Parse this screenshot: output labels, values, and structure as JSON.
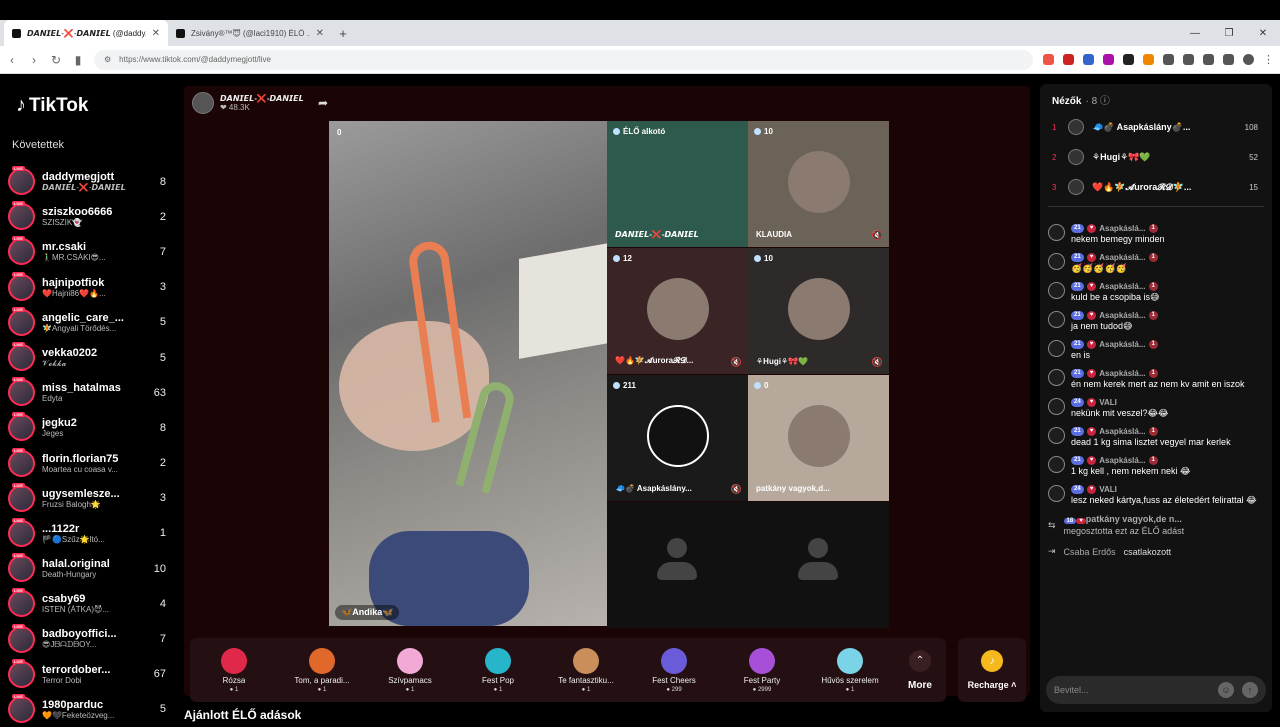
{
  "browser": {
    "tabs": [
      {
        "title": "𝘿𝘼𝙉𝙄𝙀𝙇-❌-𝘿𝘼𝙉𝙄𝙀𝙇 (@daddy..."
      },
      {
        "title": "Zsivány®™😇 (@laci1910) ÉLŐ ..."
      }
    ],
    "url": "https://www.tiktok.com/@daddymegjott/live"
  },
  "sidebar": {
    "logo": "TikTok",
    "following_title": "Követettek",
    "items": [
      {
        "name": "daddymegjott",
        "desc": "𝘿𝘼𝙉𝙄𝙀𝙇-❌-𝘿𝘼𝙉𝙄𝙀𝙇",
        "count": "8"
      },
      {
        "name": "sziszkoo6666",
        "desc": "SZISZIK👻",
        "count": "2"
      },
      {
        "name": "mr.csaki",
        "desc": "🚶‍♂️MR.CSÁKI😎...",
        "count": "7"
      },
      {
        "name": "hajnipotfiok",
        "desc": "❤️Hajni86❤️🔥...",
        "count": "3"
      },
      {
        "name": "angelic_care_...",
        "desc": "🧚Angyali Törődés...",
        "count": "5"
      },
      {
        "name": "vekka0202",
        "desc": "𝓥𝓮𝓴𝓴𝓪",
        "count": "5"
      },
      {
        "name": "miss_hatalmas",
        "desc": "Edyta",
        "count": "63"
      },
      {
        "name": "jegku2",
        "desc": "Jeges",
        "count": "8"
      },
      {
        "name": "florin.florian75",
        "desc": "Moartea cu coasa v...",
        "count": "2"
      },
      {
        "name": "ugysemlesze...",
        "desc": "Fruzsi Balogh🌟",
        "count": "3"
      },
      {
        "name": "...1122r",
        "desc": "🏴🔵Szűz🌟ltó...",
        "count": "1"
      },
      {
        "name": "halal.original",
        "desc": "Death-Hungary",
        "count": "10"
      },
      {
        "name": "csaby69",
        "desc": "ISTEN (ÁTKA)😈...",
        "count": "4"
      },
      {
        "name": "badboyoffici...",
        "desc": "😎JᗷᗩᗪᗷOY...",
        "count": "7"
      },
      {
        "name": "terrordober...",
        "desc": "Terror Dobi",
        "count": "67"
      },
      {
        "name": "1980parduc",
        "desc": "🧡🖤Feketeözveg...",
        "count": "5"
      }
    ]
  },
  "stream": {
    "host_name": "𝘿𝘼𝙉𝙄𝙀𝙇-❌-𝘿𝘼𝙉𝙄𝙀𝙇",
    "host_likes": "❤ 48.3K",
    "main_guest": {
      "count": "0",
      "name": "🦋Andika🦋"
    },
    "tiles": [
      {
        "count": "ÉLŐ alkotó",
        "label": "𝘿𝘼𝙉𝙄𝙀𝙇-❌-𝘿𝘼𝙉𝙄𝙀𝙇",
        "bg": "#2d5a4c"
      },
      {
        "count": "10",
        "label": "KLAUDIA",
        "bg": "#6b6258"
      },
      {
        "count": "12",
        "label": "❤️🔥🧚𝓐urora𝓡𝓓...",
        "bg": "#3a2426"
      },
      {
        "count": "10",
        "label": "⚘Hugi⚘🎀💚",
        "bg": "#2e2a2a"
      },
      {
        "count": "211",
        "label": "🧢💣 Asapkáslány...",
        "bg": "#1a1a1a"
      },
      {
        "count": "0",
        "label": "patkány vagyok,d...",
        "bg": "#b6a99c"
      }
    ],
    "recommended": "Ajánlott ÉLŐ adások"
  },
  "gifts": [
    {
      "name": "Rózsa",
      "price": "1",
      "color": "#e0294a"
    },
    {
      "name": "Tom, a paradi...",
      "price": "1",
      "color": "#e0682a"
    },
    {
      "name": "Szívpamacs",
      "price": "1",
      "color": "#f2a9d6"
    },
    {
      "name": "Fest Pop",
      "price": "1",
      "color": "#26b5c9"
    },
    {
      "name": "Te fantasztiku...",
      "price": "1",
      "color": "#c98e5a"
    },
    {
      "name": "Fest Cheers",
      "price": "299",
      "color": "#6a5bd8"
    },
    {
      "name": "Fest Party",
      "price": "2999",
      "color": "#a84fd8"
    },
    {
      "name": "Hűvös szerelem",
      "price": "1",
      "color": "#7bd3e8"
    }
  ],
  "more_label": "More",
  "recharge_label": "Recharge",
  "viewers": {
    "title": "Nézők",
    "count": "8",
    "top": [
      {
        "rank": "1",
        "name": "🧢💣 Asapkáslány💣...",
        "score": "108"
      },
      {
        "rank": "2",
        "name": "⚘Hugi⚘🎀💚",
        "score": "52"
      },
      {
        "rank": "3",
        "name": "❤️🔥🧚𝓐urora𝓡𝓓🧚...",
        "score": "15"
      }
    ]
  },
  "chat": [
    {
      "user": "Asapkáslá...",
      "lvl": "21",
      "fan": "1",
      "text": "nekem bemegy minden"
    },
    {
      "user": "Asapkáslá...",
      "lvl": "21",
      "fan": "1",
      "text": "🥳🥳🥳🥳🥳"
    },
    {
      "user": "Asapkáslá...",
      "lvl": "21",
      "fan": "1",
      "text": "kuld be a csopiba is😅"
    },
    {
      "user": "Asapkáslá...",
      "lvl": "21",
      "fan": "1",
      "text": "ja nem tudod😅"
    },
    {
      "user": "Asapkáslá...",
      "lvl": "21",
      "fan": "1",
      "text": "en is"
    },
    {
      "user": "Asapkáslá...",
      "lvl": "21",
      "fan": "1",
      "text": "én nem kerek mert az nem kv amit en iszok"
    },
    {
      "user": "VALI",
      "lvl": "24",
      "fan": "",
      "text": "nekünk mit veszel?😂😂"
    },
    {
      "user": "Asapkáslá...",
      "lvl": "21",
      "fan": "1",
      "text": "dead 1 kg sima lisztet vegyel mar kerlek"
    },
    {
      "user": "Asapkáslá...",
      "lvl": "21",
      "fan": "1",
      "text": "1 kg kell , nem nekem neki 😂"
    },
    {
      "user": "VALI",
      "lvl": "24",
      "fan": "",
      "text": "lesz neked kártya,fuss az életedért felirattal 😂"
    }
  ],
  "share_event": {
    "lvl": "18",
    "user": "patkány vagyok,de n...",
    "text": "megosztotta ezt az ÉLŐ adást"
  },
  "join_event": {
    "user": "Csaba Erdős",
    "text": "csatlakozott"
  },
  "chat_input": {
    "placeholder": "Bevitel..."
  }
}
